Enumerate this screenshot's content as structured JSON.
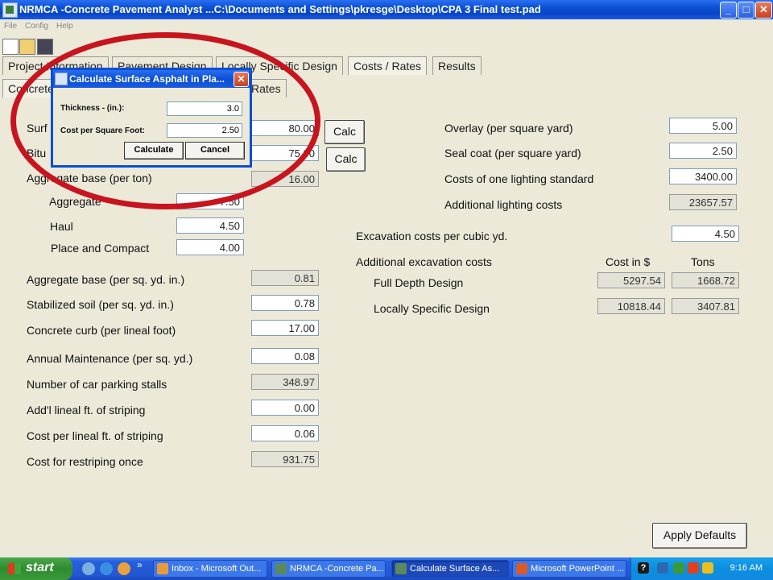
{
  "window": {
    "title": "NRMCA -Concrete Pavement Analyst ...C:\\Documents and Settings\\pkresge\\Desktop\\CPA 3 Final test.pad",
    "min_label": "_",
    "max_label": "□",
    "close_label": "✕"
  },
  "menu": [
    "File",
    "Config",
    "Help"
  ],
  "tabs_row1": [
    "Project Information",
    "Pavement Design",
    "Locally Specific Design",
    "Costs / Rates",
    "Results"
  ],
  "tabs_row2": [
    "Concrete",
    "Rates"
  ],
  "left_form": {
    "surface_label": "Surf",
    "surface_value": "80.00",
    "bitu_label": "Bitu",
    "bitu_value": "75.00",
    "calc1": "Calc",
    "calc2": "Calc",
    "agg_base_ton_label": "Aggregate base (per ton)",
    "agg_base_ton_value": "16.00",
    "aggregate_label": "Aggregate",
    "aggregate_value": "7.50",
    "haul_label": "Haul",
    "haul_value": "4.50",
    "place_label": "Place and Compact",
    "place_value": "4.00",
    "agg_sqyd_label": "Aggregate base (per sq. yd. in.)",
    "agg_sqyd_value": "0.81",
    "stab_label": "Stabilized soil (per sq. yd. in.)",
    "stab_value": "0.78",
    "curb_label": "Concrete curb (per lineal foot)",
    "curb_value": "17.00",
    "maint_label": "Annual Maintenance (per sq. yd.)",
    "maint_value": "0.08",
    "stalls_label": "Number of car parking stalls",
    "stalls_value": "348.97",
    "striping_label": "Add'l lineal ft. of striping",
    "striping_value": "0.00",
    "cost_striping_label": "Cost per lineal ft. of striping",
    "cost_striping_value": "0.06",
    "restripe_label": "Cost for restriping once",
    "restripe_value": "931.75"
  },
  "right_form": {
    "overlay_label": "Overlay (per square yard)",
    "overlay_value": "5.00",
    "seal_label": "Seal coat (per square yard)",
    "seal_value": "2.50",
    "lighting_label": "Costs of one lighting standard",
    "lighting_value": "3400.00",
    "add_lighting_label": "Additional lighting costs",
    "add_lighting_value": "23657.57",
    "excav_label": "Excavation costs per cubic yd.",
    "excav_value": "4.50",
    "add_excav_label": "Additional excavation costs",
    "cost_header": "Cost in $",
    "tons_header": "Tons",
    "full_depth_label": "Full Depth Design",
    "full_depth_cost": "5297.54",
    "full_depth_tons": "1668.72",
    "locally_label": "Locally Specific Design",
    "locally_cost": "10818.44",
    "locally_tons": "3407.81"
  },
  "apply_defaults": "Apply Defaults",
  "dialog": {
    "title": "Calculate Surface Asphalt in Pla...",
    "close_label": "✕",
    "thickness_label": "Thickness - (in.):",
    "thickness_value": "3.0",
    "cost_label": "Cost per Square Foot:",
    "cost_value": "2.50",
    "calculate": "Calculate",
    "cancel": "Cancel"
  },
  "taskbar": {
    "start": "start",
    "overflow": "»",
    "tasks": [
      "Inbox - Microsoft Out...",
      "NRMCA -Concrete Pa...",
      "Calculate Surface As...",
      "Microsoft PowerPoint ..."
    ],
    "tray_help": "?",
    "clock": "9:16 AM"
  },
  "colors": {
    "title_blue": "#0a4fd3",
    "annotation_red": "#c8141e",
    "window_bg": "#ece9d8"
  }
}
